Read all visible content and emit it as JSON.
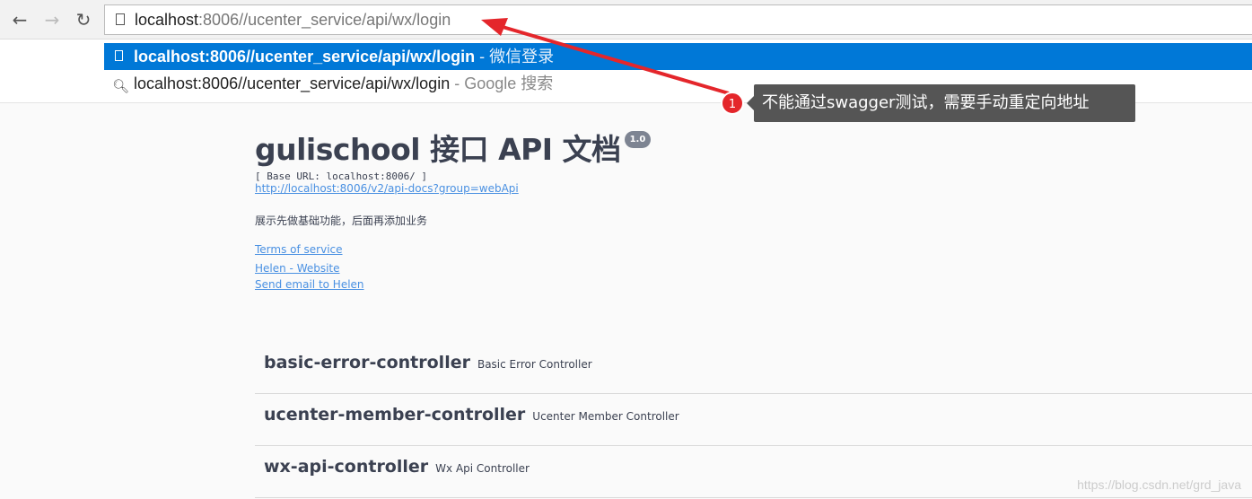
{
  "browser": {
    "url_host": "localhost",
    "url_rest": ":8006//ucenter_service/api/wx/login",
    "suggestions": [
      {
        "text": "localhost:8006//ucenter_service/api/wx/login",
        "sub": " - 微信登录",
        "icon": "page-icon"
      },
      {
        "text": "localhost:8006//ucenter_service/api/wx/login",
        "sub": " - Google 搜索",
        "icon": "search-icon"
      }
    ]
  },
  "annotation": {
    "number": "1",
    "text": "不能通过swagger测试，需要手动重定向地址",
    "color": "#e4262b"
  },
  "doc": {
    "title": "gulischool 接口 API 文档",
    "version": "1.0",
    "base_url": "[ Base URL: localhost:8006/ ]",
    "api_docs_link": "http://localhost:8006/v2/api-docs?group=webApi",
    "description": "展示先做基础功能，后面再添加业务",
    "terms": "Terms of service",
    "website": "Helen - Website",
    "email": "Send email to Helen"
  },
  "controllers": [
    {
      "name": "basic-error-controller",
      "desc": "Basic Error Controller"
    },
    {
      "name": "ucenter-member-controller",
      "desc": "Ucenter Member Controller"
    },
    {
      "name": "wx-api-controller",
      "desc": "Wx Api Controller"
    }
  ],
  "watermark": "https://blog.csdn.net/grd_java"
}
